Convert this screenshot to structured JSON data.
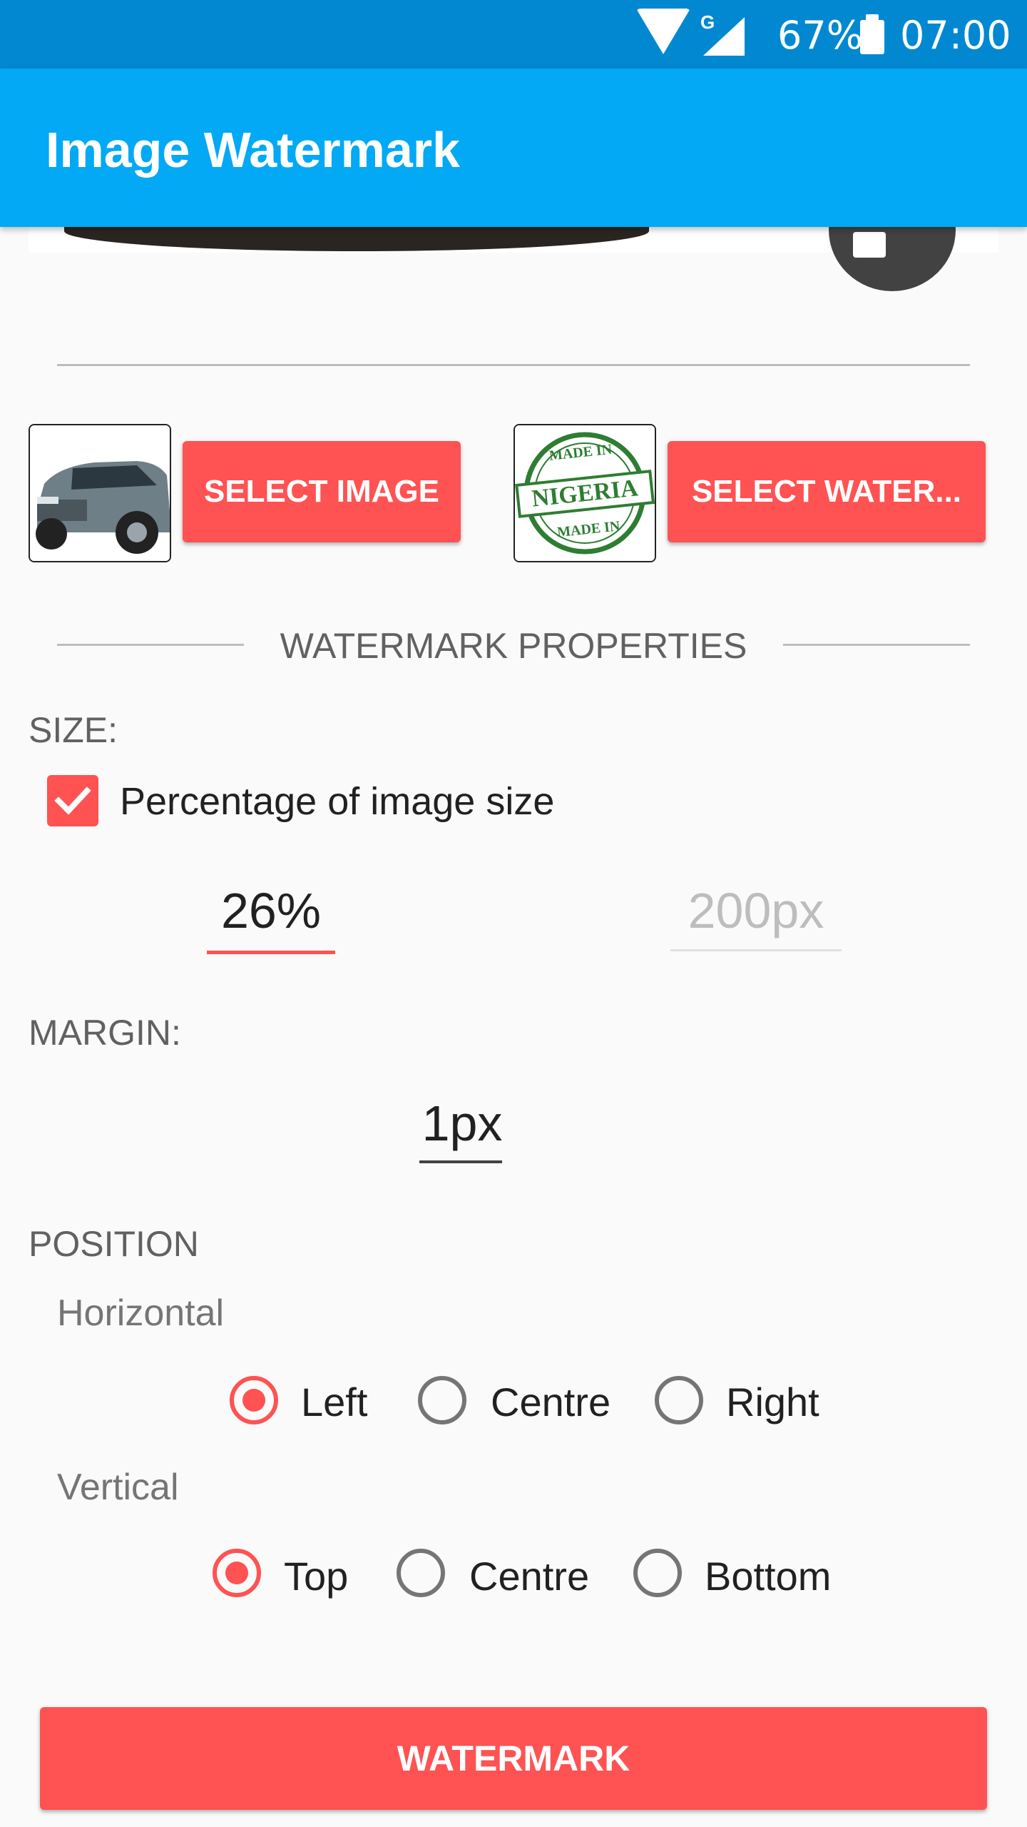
{
  "status_bar": {
    "network_letter": "G",
    "battery": "67%",
    "time": "07:00"
  },
  "app_bar": {
    "title": "Image Watermark"
  },
  "image_select": {
    "select_image_label": "SELECT IMAGE",
    "select_watermark_label": "SELECT WATER...",
    "watermark_thumb_text": {
      "top": "MADE IN",
      "middle": "NIGERIA",
      "bottom": "MADE IN"
    }
  },
  "properties": {
    "section_title": "WATERMARK PROPERTIES",
    "size": {
      "label": "SIZE:",
      "percentage_checkbox_label": "Percentage of image size",
      "percentage_checked": true,
      "percent_value": "26%",
      "pixel_placeholder": "200px"
    },
    "margin": {
      "label": "MARGIN:",
      "value": "1px"
    },
    "position": {
      "label": "POSITION",
      "horizontal": {
        "label": "Horizontal",
        "options": [
          "Left",
          "Centre",
          "Right"
        ],
        "selected": "Left"
      },
      "vertical": {
        "label": "Vertical",
        "options": [
          "Top",
          "Centre",
          "Bottom"
        ],
        "selected": "Top"
      }
    }
  },
  "actions": {
    "watermark_label": "WATERMARK"
  },
  "colors": {
    "status_bar": "#0288d1",
    "app_bar": "#03a9f4",
    "accent": "#ff5252",
    "fab": "#424242"
  }
}
